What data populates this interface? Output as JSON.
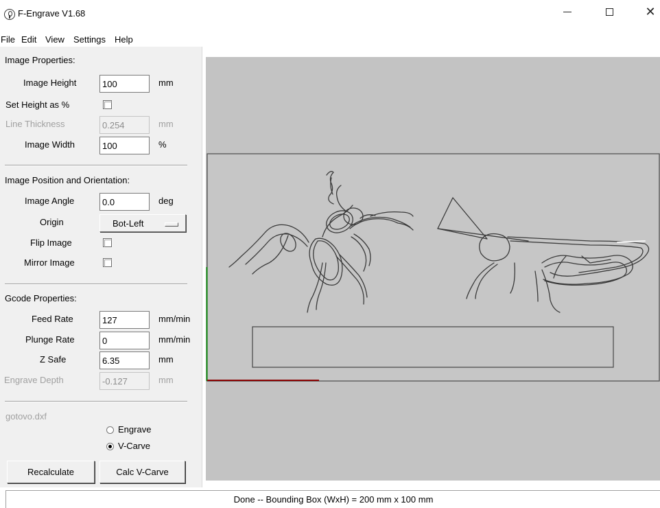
{
  "window": {
    "title": "F-Engrave V1.68",
    "minimize": "—",
    "maximize": "",
    "close": "✕"
  },
  "menu": [
    "File",
    "Edit",
    "View",
    "Settings",
    "Help"
  ],
  "image_properties": {
    "header": "Image Properties:",
    "height_label": "Image Height",
    "height_value": "100",
    "height_unit": "mm",
    "set_height_pct_label": "Set Height as %",
    "set_height_pct_checked": false,
    "line_thickness_label": "Line Thickness",
    "line_thickness_value": "0.254",
    "line_thickness_unit": "mm",
    "width_label": "Image Width",
    "width_value": "100",
    "width_unit": "%"
  },
  "position": {
    "header": "Image Position and Orientation:",
    "angle_label": "Image Angle",
    "angle_value": "0.0",
    "angle_unit": "deg",
    "origin_label": "Origin",
    "origin_value": "Bot-Left",
    "flip_label": "Flip Image",
    "flip_checked": false,
    "mirror_label": "Mirror Image",
    "mirror_checked": false
  },
  "gcode": {
    "header": "Gcode Properties:",
    "feed_label": "Feed Rate",
    "feed_value": "127",
    "feed_unit": "mm/min",
    "plunge_label": "Plunge Rate",
    "plunge_value": "0",
    "plunge_unit": "mm/min",
    "zsafe_label": "Z Safe",
    "zsafe_value": "6.35",
    "zsafe_unit": "mm",
    "depth_label": "Engrave Depth",
    "depth_value": "-0.127",
    "depth_unit": "mm"
  },
  "file_name": "gotovo.dxf",
  "mode": {
    "engrave_label": "Engrave",
    "vcarve_label": "V-Carve",
    "selected": "V-Carve"
  },
  "buttons": {
    "recalculate": "Recalculate",
    "calc_vcarve": "Calc V-Carve"
  },
  "status": "Done -- Bounding Box (WxH) = 200 mm  x 100 mm",
  "colors": {
    "canvas_bg": "#c3c3c3",
    "x_axis": "#8b0000",
    "y_axis": "#138a13"
  }
}
